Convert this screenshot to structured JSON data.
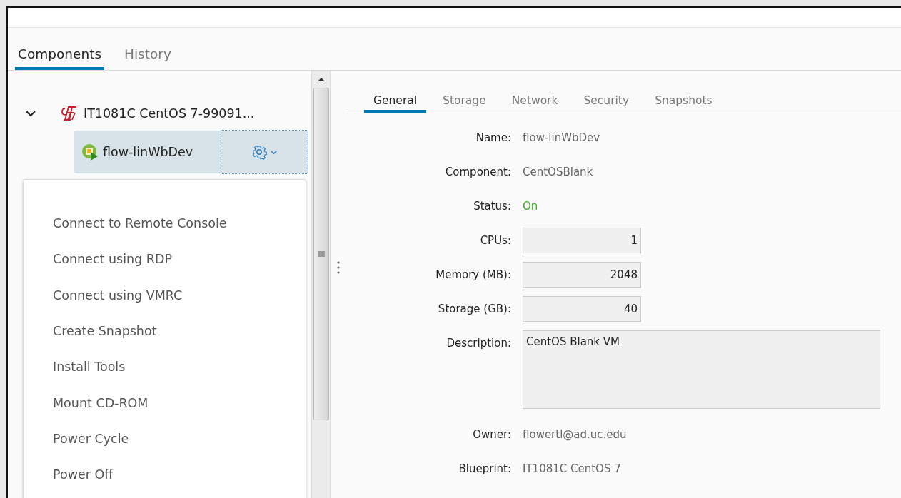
{
  "tabs": [
    {
      "label": "Components",
      "selected": true
    },
    {
      "label": "History",
      "selected": false
    }
  ],
  "tree": {
    "label": "IT1081C CentOS 7-99091...",
    "expanded": true,
    "children": [
      {
        "label": "flow-linWbDev",
        "selected": true
      }
    ]
  },
  "menu": [
    "Connect to Remote Console",
    "Connect using RDP",
    "Connect using VMRC",
    "Create Snapshot",
    "Install Tools",
    "Mount CD-ROM",
    "Power Cycle",
    "Power Off"
  ],
  "detail_tabs": [
    {
      "label": "General",
      "selected": true
    },
    {
      "label": "Storage",
      "selected": false
    },
    {
      "label": "Network",
      "selected": false
    },
    {
      "label": "Security",
      "selected": false
    },
    {
      "label": "Snapshots",
      "selected": false
    }
  ],
  "fields": [
    {
      "kind": "text",
      "label": "Name:",
      "value": "flow-linWbDev"
    },
    {
      "kind": "text",
      "label": "Component:",
      "value": "CentOSBlank"
    },
    {
      "kind": "status",
      "label": "Status:",
      "value": "On"
    },
    {
      "kind": "number",
      "label": "CPUs:",
      "value": "1"
    },
    {
      "kind": "number",
      "label": "Memory (MB):",
      "value": "2048"
    },
    {
      "kind": "number",
      "label": "Storage (GB):",
      "value": "40"
    },
    {
      "kind": "textarea",
      "label": "Description:",
      "value": "CentOS Blank VM"
    },
    {
      "kind": "text",
      "label": "Owner:",
      "value": "flowertl@ad.uc.edu"
    },
    {
      "kind": "text",
      "label": "Blueprint:",
      "value": "IT1081C CentOS 7"
    }
  ]
}
